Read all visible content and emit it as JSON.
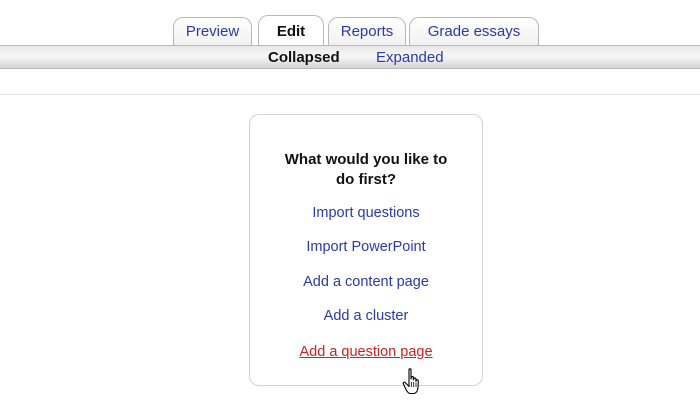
{
  "tabs": [
    {
      "label": "Preview",
      "active": false
    },
    {
      "label": "Edit",
      "active": true
    },
    {
      "label": "Reports",
      "active": false
    },
    {
      "label": "Grade essays",
      "active": false
    }
  ],
  "subtabs": {
    "current": "Collapsed",
    "other": "Expanded"
  },
  "panel": {
    "title_line1": "What would you like to",
    "title_line2": "do first?",
    "actions": [
      {
        "label": "Import questions"
      },
      {
        "label": "Import PowerPoint"
      },
      {
        "label": "Add a content page"
      },
      {
        "label": "Add a cluster"
      },
      {
        "label": "Add a question page",
        "hovered": true
      }
    ]
  },
  "colors": {
    "link": "#2a3aa6",
    "link_hover": "#cc2222",
    "text": "#111111"
  },
  "cursor": {
    "icon": "hand-pointer-icon"
  }
}
